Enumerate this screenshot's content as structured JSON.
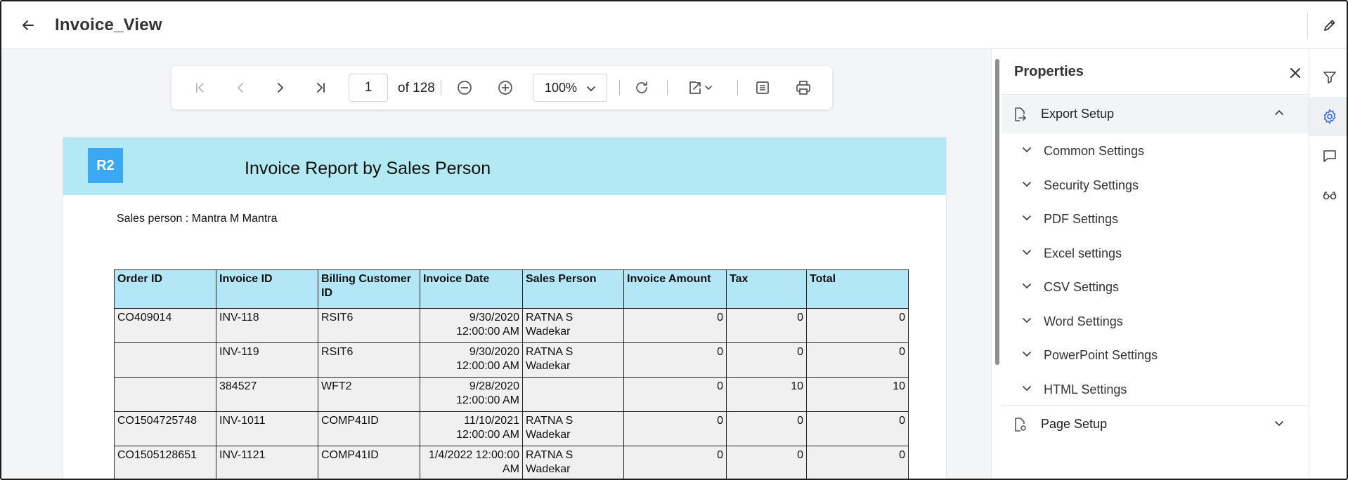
{
  "header": {
    "title": "Invoice_View",
    "back_icon": "arrow-left-icon",
    "edit_icon": "pencil-icon"
  },
  "toolbar": {
    "current_page": "1",
    "page_total_label": "of 128",
    "zoom_value": "100%",
    "icons": [
      "first-page-icon",
      "prev-page-icon",
      "next-page-icon",
      "last-page-icon",
      "zoom-out-icon",
      "zoom-in-icon",
      "refresh-icon",
      "export-icon",
      "document-view-icon",
      "print-icon"
    ]
  },
  "report": {
    "logo_text": "R2",
    "title": "Invoice Report by Sales Person",
    "sales_person_line": "Sales person : Mantra M Mantra",
    "columns": [
      "Order ID",
      "Invoice ID",
      "Billing Customer ID",
      "Invoice Date",
      "Sales Person",
      "Invoice Amount",
      "Tax",
      "Total"
    ],
    "rows": [
      [
        "CO409014",
        "INV-118",
        "RSIT6",
        "9/30/2020 12:00:00 AM",
        "RATNA S Wadekar",
        "0",
        "0",
        "0"
      ],
      [
        "",
        "INV-119",
        "RSIT6",
        "9/30/2020 12:00:00 AM",
        "RATNA S Wadekar",
        "0",
        "0",
        "0"
      ],
      [
        "",
        "384527",
        "WFT2",
        "9/28/2020 12:00:00 AM",
        "",
        "0",
        "10",
        "10"
      ],
      [
        "CO1504725748",
        "INV-1011",
        "COMP41ID",
        "11/10/2021 12:00:00 AM",
        "RATNA S Wadekar",
        "0",
        "0",
        "0"
      ],
      [
        "CO1505128651",
        "INV-1121",
        "COMP41ID",
        "1/4/2022 12:00:00 AM",
        "RATNA S Wadekar",
        "0",
        "0",
        "0"
      ]
    ]
  },
  "properties": {
    "title": "Properties",
    "export_setup_label": "Export Setup",
    "settings": [
      "Common Settings",
      "Security Settings",
      "PDF Settings",
      "Excel settings",
      "CSV Settings",
      "Word Settings",
      "PowerPoint Settings",
      "HTML Settings"
    ],
    "page_setup_label": "Page Setup"
  },
  "rail": {
    "icons": [
      "filter-icon",
      "gear-icon",
      "comment-icon",
      "glasses-icon"
    ],
    "active": "gear-icon"
  },
  "colors": {
    "accent": "#3b6cd9",
    "report_band": "#b3e9f2",
    "table_header": "#b3e6f7",
    "logo": "#3aa8f3"
  }
}
